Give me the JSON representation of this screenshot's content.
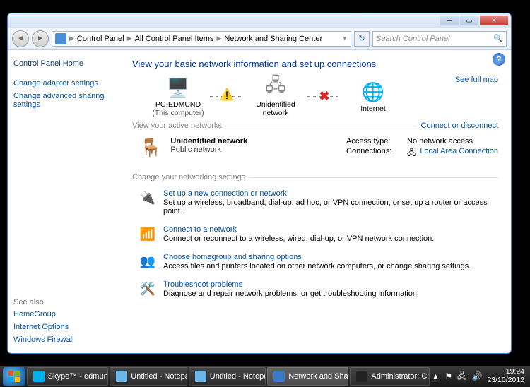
{
  "titlebar": {
    "min": "─",
    "max": "▭",
    "close": "✕"
  },
  "address": {
    "crumbs": [
      "Control Panel",
      "All Control Panel Items",
      "Network and Sharing Center"
    ],
    "search_placeholder": "Search Control Panel",
    "refresh": "↻",
    "dropdown": "▾"
  },
  "sidebar": {
    "home": "Control Panel Home",
    "links": [
      "Change adapter settings",
      "Change advanced sharing settings"
    ],
    "seealso_label": "See also",
    "seealso": [
      "HomeGroup",
      "Internet Options",
      "Windows Firewall"
    ]
  },
  "content": {
    "heading": "View your basic network information and set up connections",
    "full_map": "See full map",
    "nodes": {
      "pc": "PC-EDMUND",
      "pc_sub": "(This computer)",
      "unidentified": "Unidentified network",
      "internet": "Internet"
    },
    "active_label": "View your active networks",
    "connect_link": "Connect or disconnect",
    "active": {
      "name": "Unidentified network",
      "type": "Public network",
      "access_label": "Access type:",
      "access_value": "No network access",
      "conn_label": "Connections:",
      "conn_value": "Local Area Connection"
    },
    "settings_label": "Change your networking settings",
    "tasks": [
      {
        "title": "Set up a new connection or network",
        "desc": "Set up a wireless, broadband, dial-up, ad hoc, or VPN connection; or set up a router or access point."
      },
      {
        "title": "Connect to a network",
        "desc": "Connect or reconnect to a wireless, wired, dial-up, or VPN network connection."
      },
      {
        "title": "Choose homegroup and sharing options",
        "desc": "Access files and printers located on other network computers, or change sharing settings."
      },
      {
        "title": "Troubleshoot problems",
        "desc": "Diagnose and repair network problems, or get troubleshooting information."
      }
    ]
  },
  "taskbar": {
    "items": [
      "Skype™ - edmun…",
      "Untitled - Notepad",
      "Untitled - Notepad",
      "Network and Sha…",
      "Administrator: C:…"
    ],
    "time": "19:24",
    "date": "23/10/2012"
  }
}
